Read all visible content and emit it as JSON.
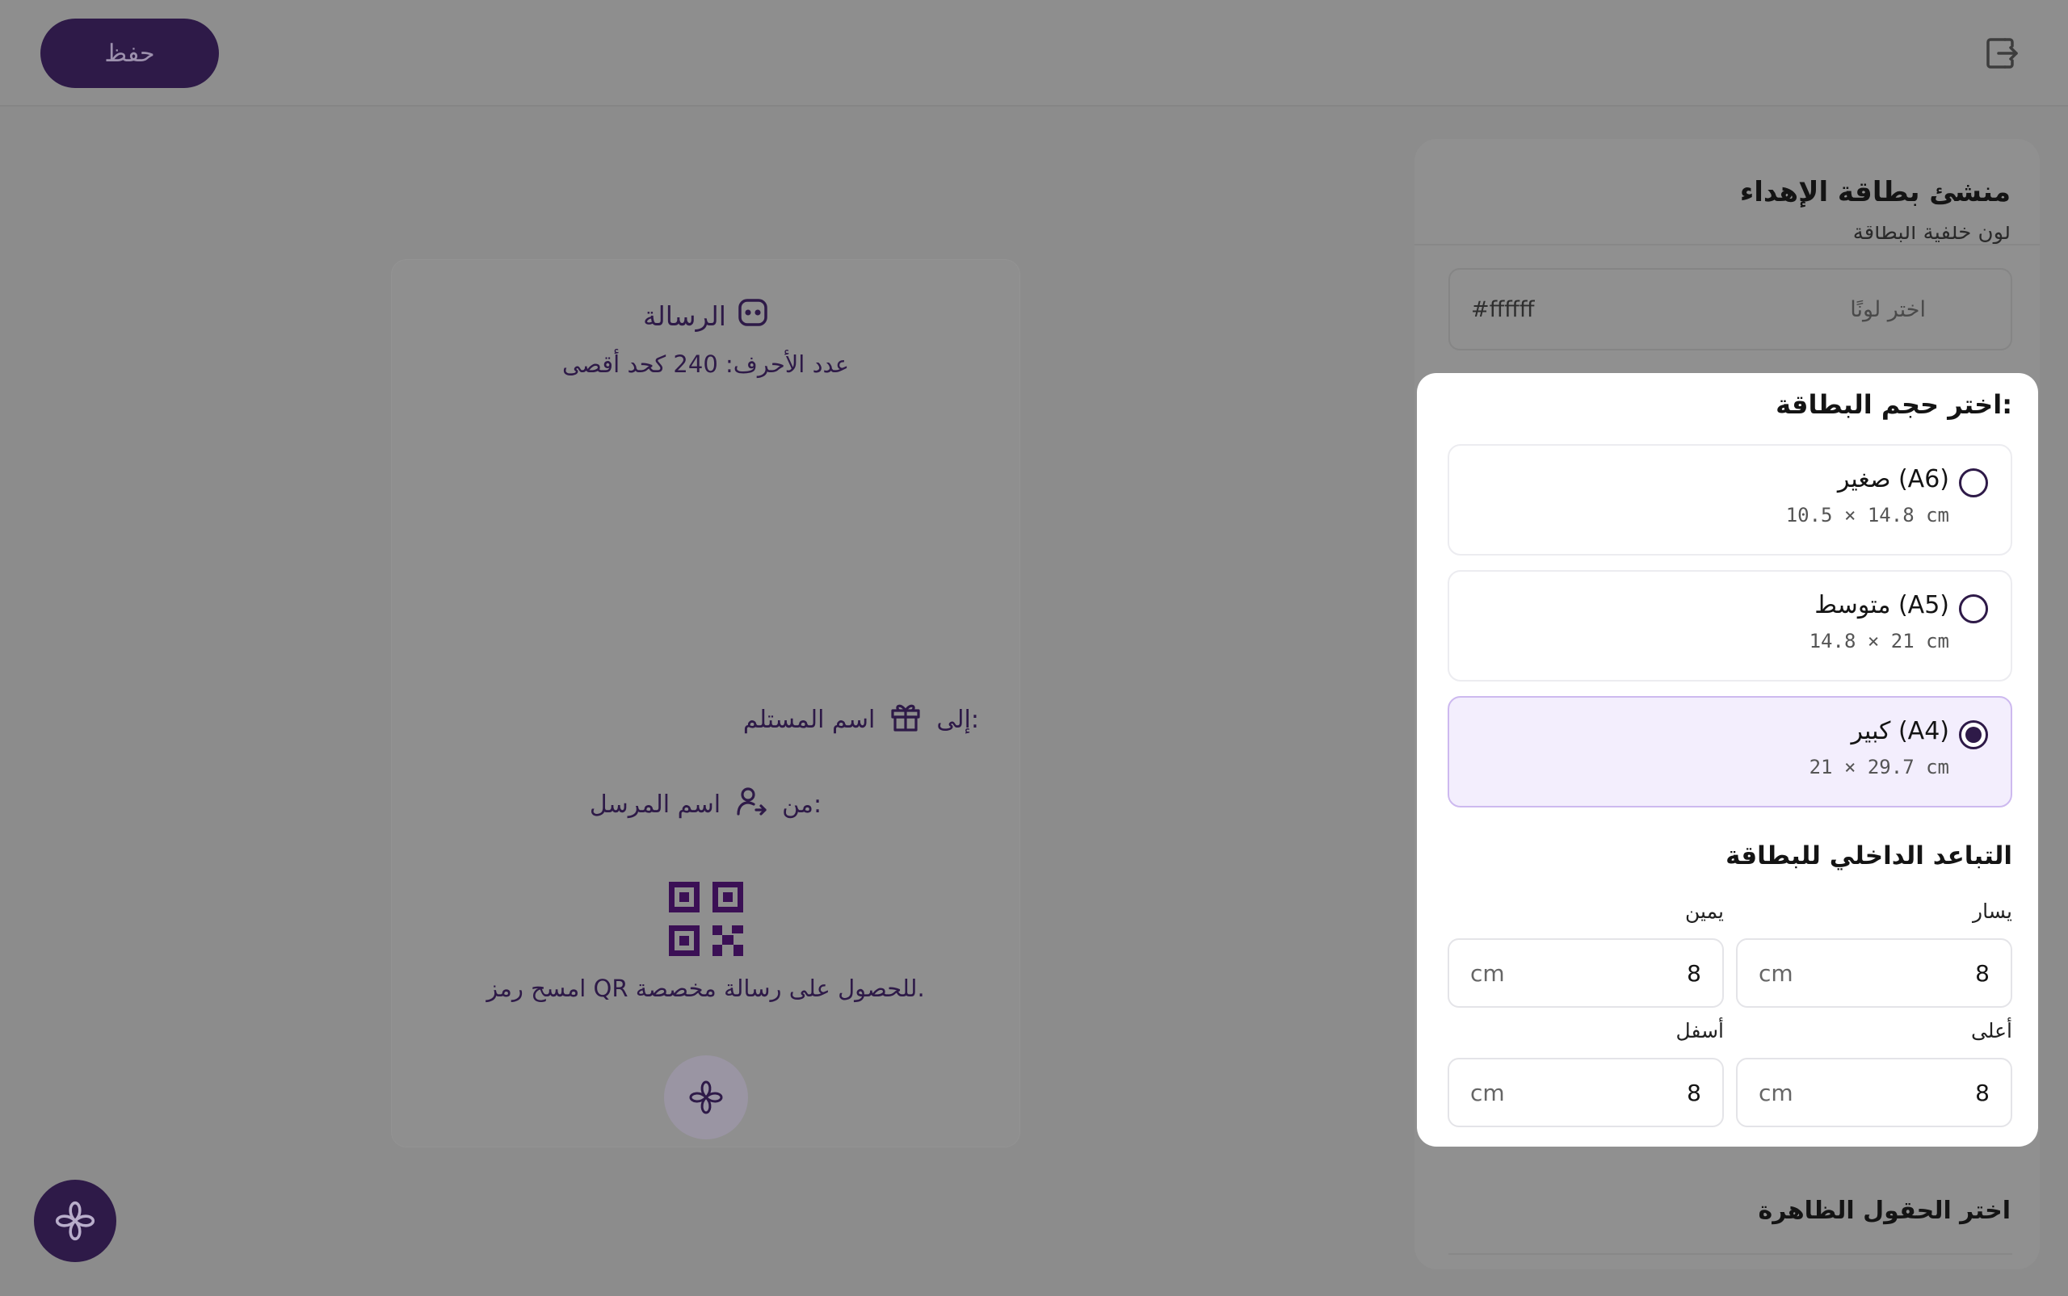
{
  "toolbar": {
    "save_label": "حفظ"
  },
  "preview": {
    "message_heading": "الرسالة",
    "char_limit": "عدد الأحرف: 240 كحد أقصى",
    "to_label": "إلى:",
    "recipient_placeholder": "اسم المستلم",
    "from_label": "من:",
    "sender_placeholder": "اسم المرسل",
    "qr_caption": "امسح رمز QR للحصول على رسالة مخصصة."
  },
  "panel": {
    "title": "منشئ بطاقة الإهداء",
    "partial_label": "لون خلفية البطاقة",
    "color_placeholder": "اختر لونًا",
    "color_value": "#ffffff",
    "visible_fields_title": "اختر الحقول الظاهرة"
  },
  "size_dialog": {
    "title": "اختر حجم البطاقة:",
    "options": [
      {
        "label": "صغير (A6)",
        "dimensions": "10.5 × 14.8 cm",
        "selected": false
      },
      {
        "label": "متوسط (A5)",
        "dimensions": "14.8 × 21 cm",
        "selected": false
      },
      {
        "label": "كبير (A4)",
        "dimensions": "21 × 29.7 cm",
        "selected": true
      }
    ],
    "padding_title": "التباعد الداخلي للبطاقة",
    "padding": {
      "left": {
        "label": "يسار",
        "value": "8",
        "unit": "cm"
      },
      "right": {
        "label": "يمين",
        "value": "8",
        "unit": "cm"
      },
      "top": {
        "label": "أعلى",
        "value": "8",
        "unit": "cm"
      },
      "bottom": {
        "label": "أسفل",
        "value": "8",
        "unit": "cm"
      }
    }
  },
  "colors": {
    "brand": "#2e1a48",
    "overlay": "#8c8c8c",
    "selected_bg": "#f3eefd"
  },
  "icons": {
    "exit": "exit-icon",
    "message": "message-icon",
    "gift": "gift-icon",
    "user": "user-arrow-icon",
    "qr": "qr-code-icon",
    "flower": "flower-icon"
  }
}
